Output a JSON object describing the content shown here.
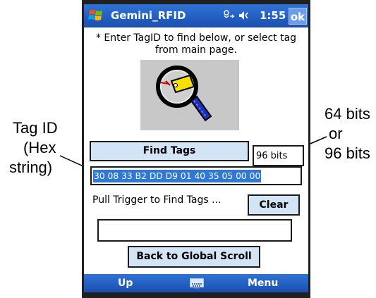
{
  "annotations": {
    "tag_id_line1": "Tag ID",
    "tag_id_line2": "(Hex",
    "tag_id_line3": "string)",
    "bits_line1": "64 bits",
    "bits_line2": "or",
    "bits_line3": "96 bits"
  },
  "titlebar": {
    "app_title": "Gemini_RFID",
    "status_icons": "connectivity-icon volume-icon",
    "time": "1:55",
    "ok_label": "ok"
  },
  "main": {
    "instruction": "* Enter TagID to find below, or select tag from main page.",
    "image_icon": "magnifier-tag-icon",
    "find_button": "Find Tags",
    "bits_value": "96 bits",
    "tag_value": "30 08 33 B2 DD D9 01 40 35 05 00 00",
    "pull_text": "Pull Trigger to Find Tags ...",
    "clear_button": "Clear",
    "status_field": "",
    "back_button": "Back to Global Scroll"
  },
  "softbar": {
    "left": "Up",
    "keyboard_icon": "keyboard-icon",
    "right": "Menu"
  },
  "colors": {
    "titlebar": "#2f73d6",
    "button_fill": "#d3e4f6",
    "selection": "#2d79d5"
  }
}
